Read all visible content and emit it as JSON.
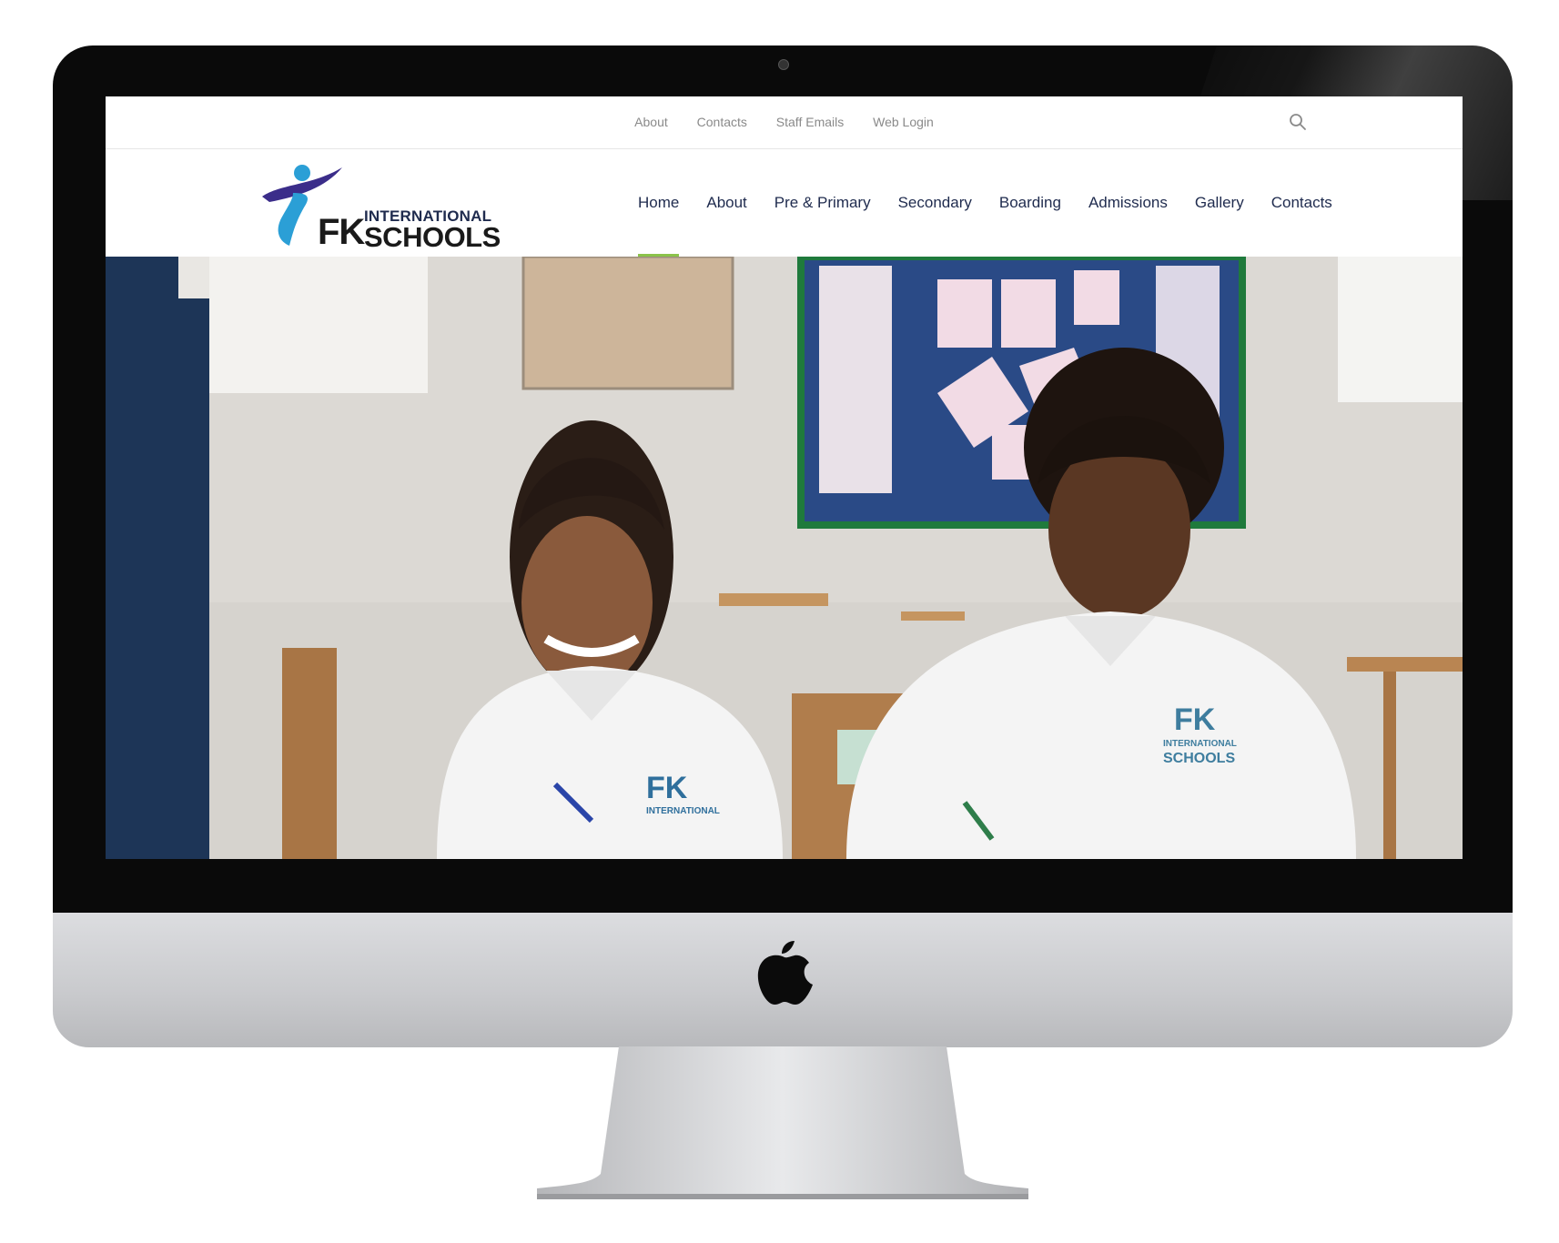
{
  "topbar": {
    "links": [
      "About",
      "Contacts",
      "Staff Emails",
      "Web Login"
    ]
  },
  "logo": {
    "line1": "INTERNATIONAL",
    "mark": "FK",
    "line2": "SCHOOLS"
  },
  "nav": {
    "items": [
      "Home",
      "About",
      "Pre & Primary",
      "Secondary",
      "Boarding",
      "Admissions",
      "Gallery",
      "Contacts"
    ],
    "active": "Home"
  },
  "hero": {
    "shirt_logo_left": "FK",
    "shirt_logo_left_sub": "INTERNATIONAL",
    "shirt_logo_right": "FK",
    "shirt_logo_right_sub1": "INTERNATIONAL",
    "shirt_logo_right_sub2": "SCHOOLS"
  },
  "colors": {
    "navy": "#1f2b4e",
    "accent_green": "#8bc34a",
    "logo_blue": "#2b9fd6",
    "logo_purple": "#3b2d8a",
    "hero_panel": "#1d3557"
  },
  "icons": {
    "search": "search-icon",
    "brand": "apple-icon"
  }
}
